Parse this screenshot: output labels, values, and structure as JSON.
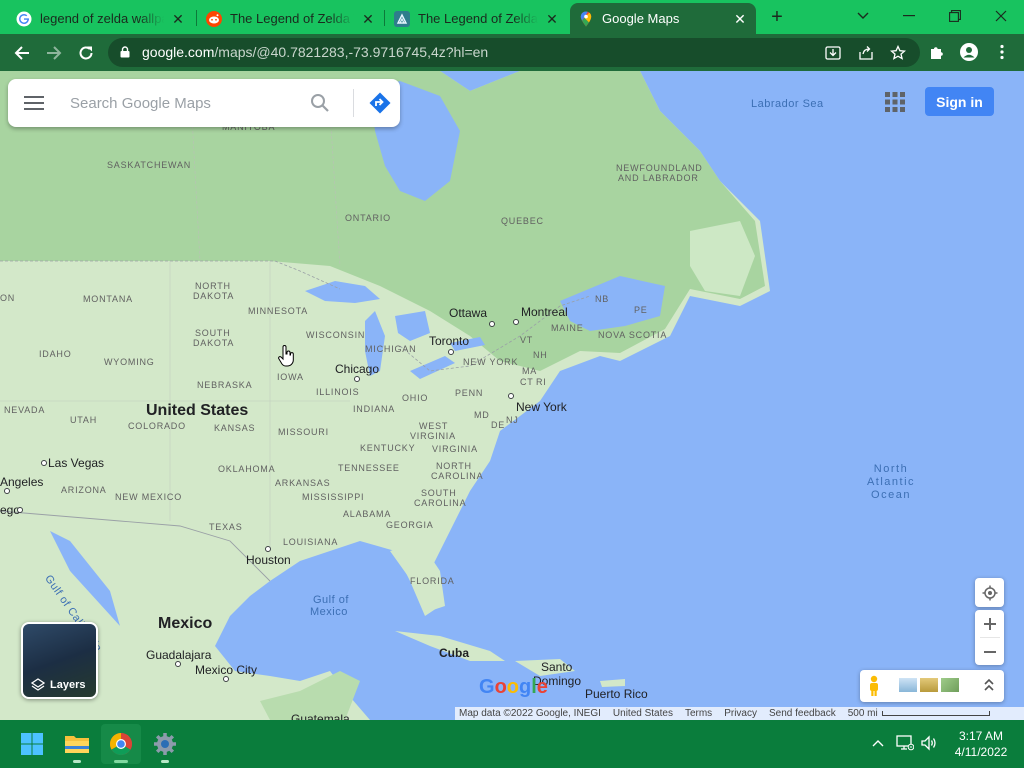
{
  "browser": {
    "tabs": [
      {
        "title": "legend of zelda wallpa",
        "favicon": "google-icon",
        "active": false
      },
      {
        "title": "The Legend of Zelda W",
        "favicon": "reddit-icon",
        "active": false
      },
      {
        "title": "The Legend of Zelda W",
        "favicon": "zelda-wiki-icon",
        "active": false
      },
      {
        "title": "Google Maps",
        "favicon": "google-maps-icon",
        "active": true
      }
    ],
    "url_host": "google.com",
    "url_path": "/maps/@40.7821283,-73.9716745,4z?hl=en"
  },
  "maps": {
    "search_placeholder": "Search Google Maps",
    "sign_in": "Sign in",
    "layers": "Layers",
    "google_logo": "Google",
    "attribution": [
      "Map data ©2022 Google, INEGI",
      "United States",
      "Terms",
      "Privacy",
      "Send feedback",
      "500 mi"
    ],
    "labels": {
      "countries": [
        "United States",
        "Mexico"
      ],
      "provinces": [
        "MANITOBA",
        "SASKATCHEWAN",
        "ONTARIO",
        "QUEBEC",
        "NEWFOUNDLAND",
        "AND LABRADOR",
        "NB",
        "PE",
        "NOVA SCOTIA"
      ],
      "states": [
        "NORTH",
        "DAKOTA",
        "SOUTH",
        "DAKOTA",
        "MONTANA",
        "MINNESOTA",
        "WISCONSIN",
        "MICHIGAN",
        "IDAHO",
        "WYOMING",
        "NEBRASKA",
        "IOWA",
        "ILLINOIS",
        "INDIANA",
        "OHIO",
        "PENN",
        "NEW YORK",
        "VT",
        "NH",
        "MAINE",
        "MA",
        "CT",
        "RI",
        "NJ",
        "MD",
        "DE",
        "NEVADA",
        "UTAH",
        "COLORADO",
        "KANSAS",
        "MISSOURI",
        "KENTUCKY",
        "WEST",
        "VIRGINIA",
        "VIRGINIA",
        "ARIZONA",
        "NEW MEXICO",
        "OKLAHOMA",
        "ARKANSAS",
        "TENNESSEE",
        "NORTH",
        "CAROLINA",
        "SOUTH",
        "CAROLINA",
        "MISSISSIPPI",
        "ALABAMA",
        "GEORGIA",
        "TEXAS",
        "LOUISIANA",
        "FLORIDA",
        "ON"
      ],
      "cities": [
        "Ottawa",
        "Montreal",
        "Toronto",
        "Chicago",
        "New York",
        "Las Vegas",
        "Angeles",
        "Houston",
        "Guadalajara",
        "Mexico City",
        "Cuba",
        "Santo",
        "Domingo",
        "Puerto Rico",
        "ego",
        "Guatemala"
      ],
      "water": [
        "Labrador Sea",
        "Gulf of",
        "Mexico",
        "Gulf of California"
      ],
      "ocean": [
        "North",
        "Atlantic",
        "Ocean"
      ]
    }
  },
  "taskbar": {
    "time": "3:17 AM",
    "date": "4/11/2022",
    "apps": [
      "windows-start-icon",
      "file-explorer-icon",
      "chrome-icon",
      "settings-icon"
    ]
  },
  "colors": {
    "tabbar": "#18c35f",
    "toolbar": "#1f6b3a",
    "water": "#8ab4f8",
    "land": "#cde8c5",
    "accent": "#4285f4",
    "taskbar": "#0a7d3c"
  }
}
